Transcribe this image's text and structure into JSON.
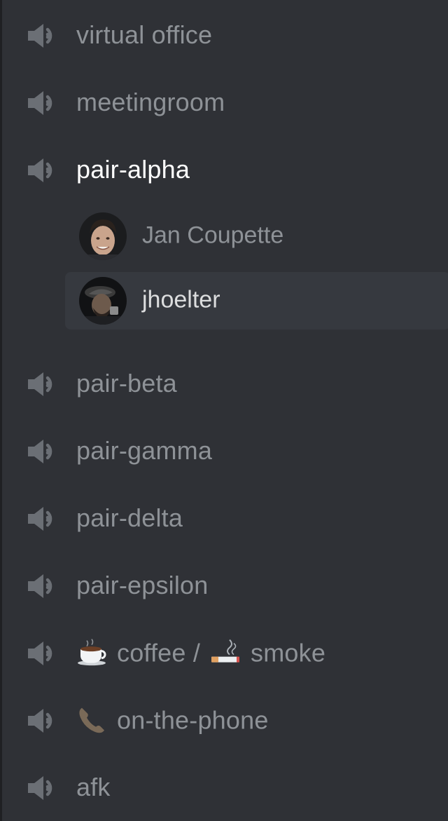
{
  "channels_top": [
    {
      "label": "virtual office"
    },
    {
      "label": "meetingroom"
    },
    {
      "label": "pair-alpha"
    }
  ],
  "voice_users": [
    {
      "name": "Jan Coupette"
    },
    {
      "name": "jhoelter"
    }
  ],
  "channels_bottom": [
    {
      "label": "pair-beta"
    },
    {
      "label": "pair-gamma"
    },
    {
      "label": "pair-delta"
    },
    {
      "label": "pair-epsilon"
    },
    {
      "label": "afk"
    }
  ],
  "coffee_channel": {
    "emoji_1": "☕",
    "text_1": "coffee /",
    "emoji_2": "🚬",
    "text_2": "smoke"
  },
  "phone_channel": {
    "emoji": "📞",
    "text": "on-the-phone"
  },
  "colors": {
    "background": "#2f3136",
    "muted_text": "#8e9297",
    "active_text": "#ffffff",
    "hover_row": "#36393f"
  },
  "icons": {
    "channel": "speaker-icon"
  }
}
